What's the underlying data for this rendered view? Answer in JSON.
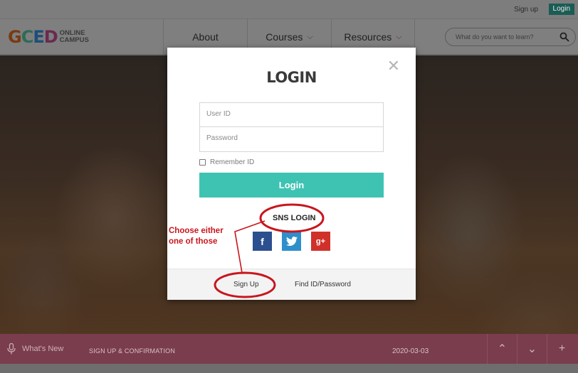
{
  "topbar": {
    "signup": "Sign up",
    "login": "Login"
  },
  "header": {
    "logo": {
      "main": [
        "G",
        "C",
        "E",
        "D"
      ],
      "line1": "ONLINE",
      "line2": "CAMPUS"
    },
    "nav": [
      {
        "label": "About",
        "chevron": false
      },
      {
        "label": "Courses",
        "chevron": true
      },
      {
        "label": "Resources",
        "chevron": true
      }
    ],
    "search": {
      "placeholder": "What do you want to learn?",
      "icon": "search-icon"
    }
  },
  "modal": {
    "title": "LOGIN",
    "close_icon": "close-icon",
    "user_placeholder": "User ID",
    "password_placeholder": "Password",
    "remember": "Remember ID",
    "login_button": "Login",
    "sns_label": "SNS LOGIN",
    "sns": [
      {
        "name": "facebook",
        "glyph": "f",
        "color": "#2c4f8f"
      },
      {
        "name": "twitter",
        "glyph": "t",
        "color": "#2f8fcb"
      },
      {
        "name": "google-plus",
        "glyph": "g+",
        "color": "#d0302a"
      }
    ],
    "footer": {
      "signup": "Sign Up",
      "find": "Find ID/Password"
    }
  },
  "annotation": {
    "line1": "Choose either",
    "line2": "one of those",
    "color": "#c8161d"
  },
  "newsbar": {
    "label": "What's New",
    "title": "SIGN UP & CONFIRMATION",
    "date": "2020-03-03",
    "controls": [
      "chevron-up-icon",
      "chevron-down-icon",
      "plus-icon"
    ]
  }
}
